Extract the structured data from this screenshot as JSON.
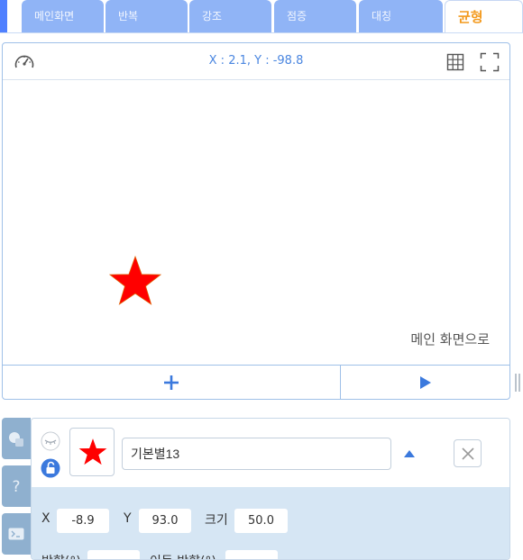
{
  "tabs": [
    {
      "label": "메인화면"
    },
    {
      "label": "반복"
    },
    {
      "label": "강조"
    },
    {
      "label": "점증"
    },
    {
      "label": "대칭"
    },
    {
      "label": "균형"
    }
  ],
  "stage": {
    "coordinates": "X : 2.1, Y : -98.8",
    "to_main_label": "메인 화면으로",
    "icons": {
      "speed": "speedometer-icon",
      "grid": "grid-icon",
      "fullscreen": "fullscreen-icon",
      "add": "plus-icon",
      "play": "play-icon",
      "sprite": "red-star"
    }
  },
  "object": {
    "name": "기본별13",
    "x_label": "X",
    "x_value": "-8.9",
    "y_label": "Y",
    "y_value": "93.0",
    "size_label": "크기",
    "size_value": "50.0",
    "row2_labels": [
      "방향(°)",
      "이동 방향(°)"
    ]
  },
  "colors": {
    "tab": "#90b4f6",
    "active_tab_text": "#f39a1e",
    "star": "#ff0000",
    "accent": "#4a86e0",
    "props_bg": "#d6e6f4"
  }
}
